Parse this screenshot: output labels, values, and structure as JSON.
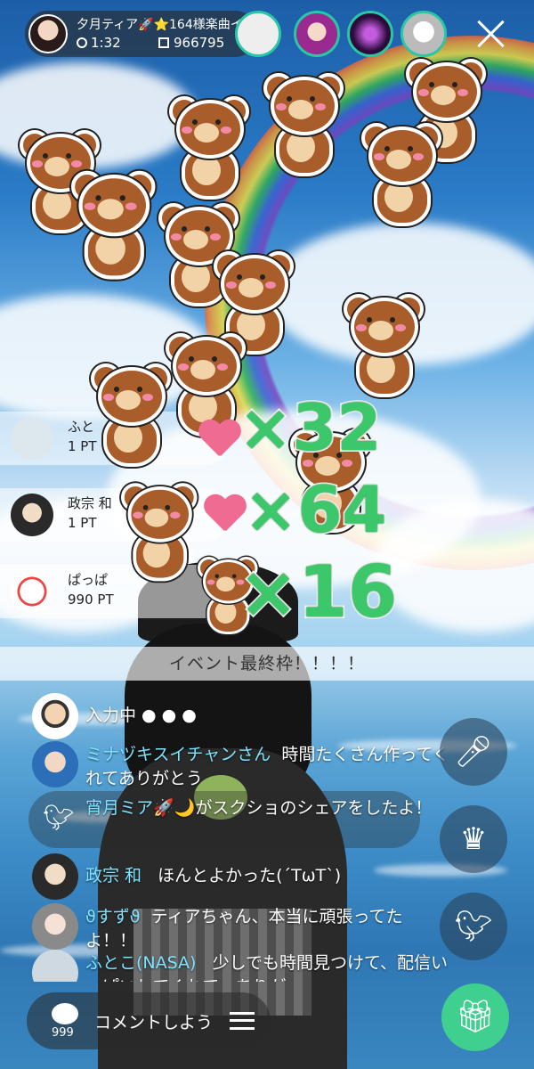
{
  "host": {
    "name": "夕月ティア🚀⭐164様楽曲イ…",
    "time": "1:32",
    "points": "966795"
  },
  "ranking": [
    {
      "name": "ふと",
      "points": "1 PT"
    },
    {
      "name": "政宗 和",
      "points": "1 PT"
    },
    {
      "name": "ぱっぱ",
      "points": "990 PT"
    }
  ],
  "gift_multipliers": [
    "×32",
    "×64",
    "×16"
  ],
  "banner": "イベント最終枠！！！！",
  "chat": {
    "typing": {
      "label": "入力中 ● ● ●"
    },
    "messages": [
      {
        "user": "ミナヅキスイチャンさん",
        "text": "時間たくさん作ってくれてありがとう"
      },
      {
        "user": "宵月ミア🚀🌙",
        "text": "がスクショのシェアをしたよ！"
      },
      {
        "user": "政宗 和",
        "text": "ほんとよかった(´TωT`)"
      },
      {
        "user": "ϑすずϑ",
        "text": "ティアちゃん、本当に頑張ってたよ！！"
      },
      {
        "user": "ふとこ(NASA)",
        "text": "少しでも時間見つけて、配信いっぱいしてくれて、ありが"
      }
    ]
  },
  "comment_bar": {
    "label": "コメントしよう",
    "count": "999"
  },
  "icons": {
    "close": "close-icon",
    "mic": "microphone-list-icon",
    "crown": "crown-icon",
    "twitter": "twitter-icon",
    "gift": "gift-icon"
  },
  "colors": {
    "accent": "#3fcf8e",
    "viewer_ring": "#29c7a5",
    "chat_name": "#7ee3ff",
    "multiplier": "#3cc76b"
  }
}
